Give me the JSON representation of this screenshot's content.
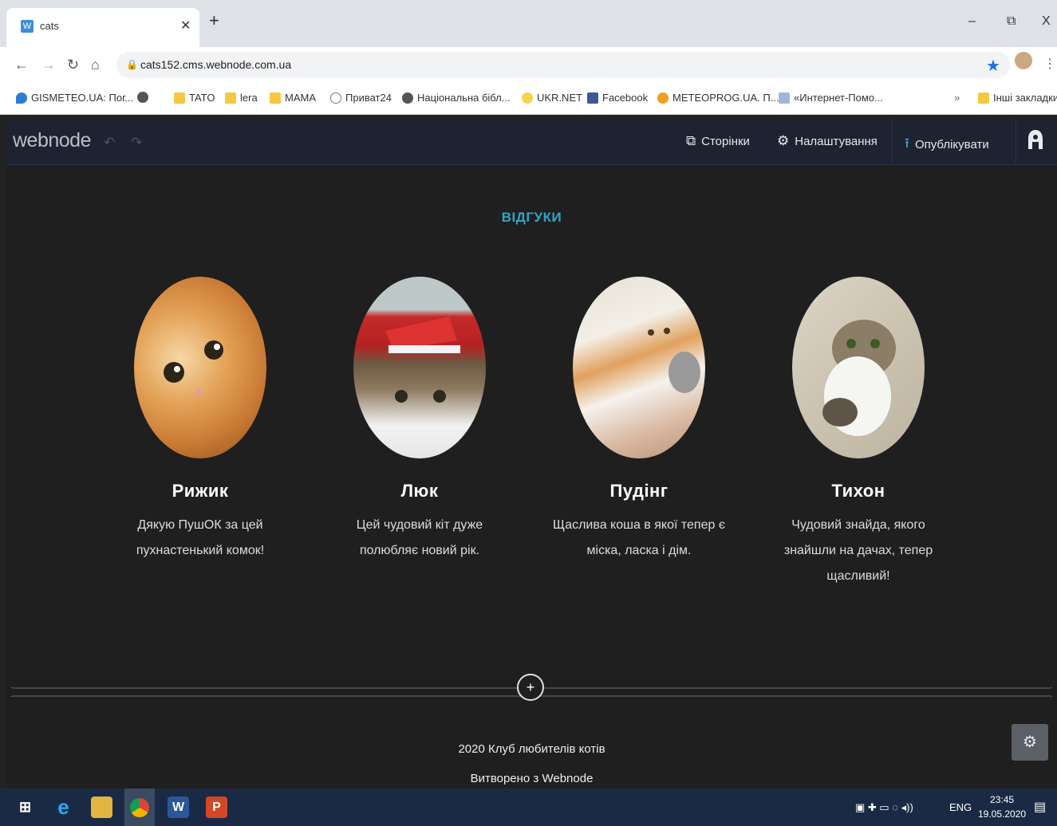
{
  "browser": {
    "tab_title": "cats",
    "tab_favicon": "W",
    "url": "cats152.cms.webnode.com.ua",
    "window_controls": [
      "–",
      "⧉",
      "X"
    ],
    "bookmarks": [
      {
        "label": "GISMETEO.UA: Пог...",
        "icon": "gismeteo-icon"
      },
      {
        "label": "",
        "icon": "globe-icon"
      },
      {
        "label": "TATO",
        "icon": "folder-icon"
      },
      {
        "label": "lera",
        "icon": "folder-icon"
      },
      {
        "label": "MAMA",
        "icon": "folder-icon"
      },
      {
        "label": "Приват24",
        "icon": "privat24-icon"
      },
      {
        "label": "Національна бібл...",
        "icon": "globe-icon"
      },
      {
        "label": "UKR.NET",
        "icon": "ukrnet-icon"
      },
      {
        "label": "Facebook",
        "icon": "facebook-icon"
      },
      {
        "label": "METEOPROG.UA. П...",
        "icon": "meteoprog-icon"
      },
      {
        "label": "«Интернет-Помо...",
        "icon": "doc-icon"
      }
    ],
    "bookmarks_more": "»",
    "other_bookmarks": "Інші закладки"
  },
  "webnode": {
    "logo": "webnode",
    "pages_label": "Сторінки",
    "settings_label": "Налаштування",
    "publish_label": "Опублікувати"
  },
  "section": {
    "title": "ВІДГУКИ",
    "cards": [
      {
        "name": "Рижик",
        "line1": "Дякую ПушОК за цей",
        "line2": "пухнастенький комок!",
        "line3": ""
      },
      {
        "name": "Люк",
        "line1": "Цей чудовий кіт дуже",
        "line2": "полюбляє новий рік.",
        "line3": ""
      },
      {
        "name": "Пудінг",
        "line1": "Щаслива коша в якої тепер є",
        "line2": "міска, ласка і дім.",
        "line3": ""
      },
      {
        "name": "Тихон",
        "line1": "Чудовий знайда, якого",
        "line2": "знайшли на дачах, тепер",
        "line3": "щасливий!"
      }
    ]
  },
  "footer": {
    "copyright": "2020 Клуб любителів котів",
    "made_with": "Витворено з Webnode"
  },
  "taskbar": {
    "lang": "ENG",
    "time": "23:45",
    "date": "19.05.2020"
  }
}
